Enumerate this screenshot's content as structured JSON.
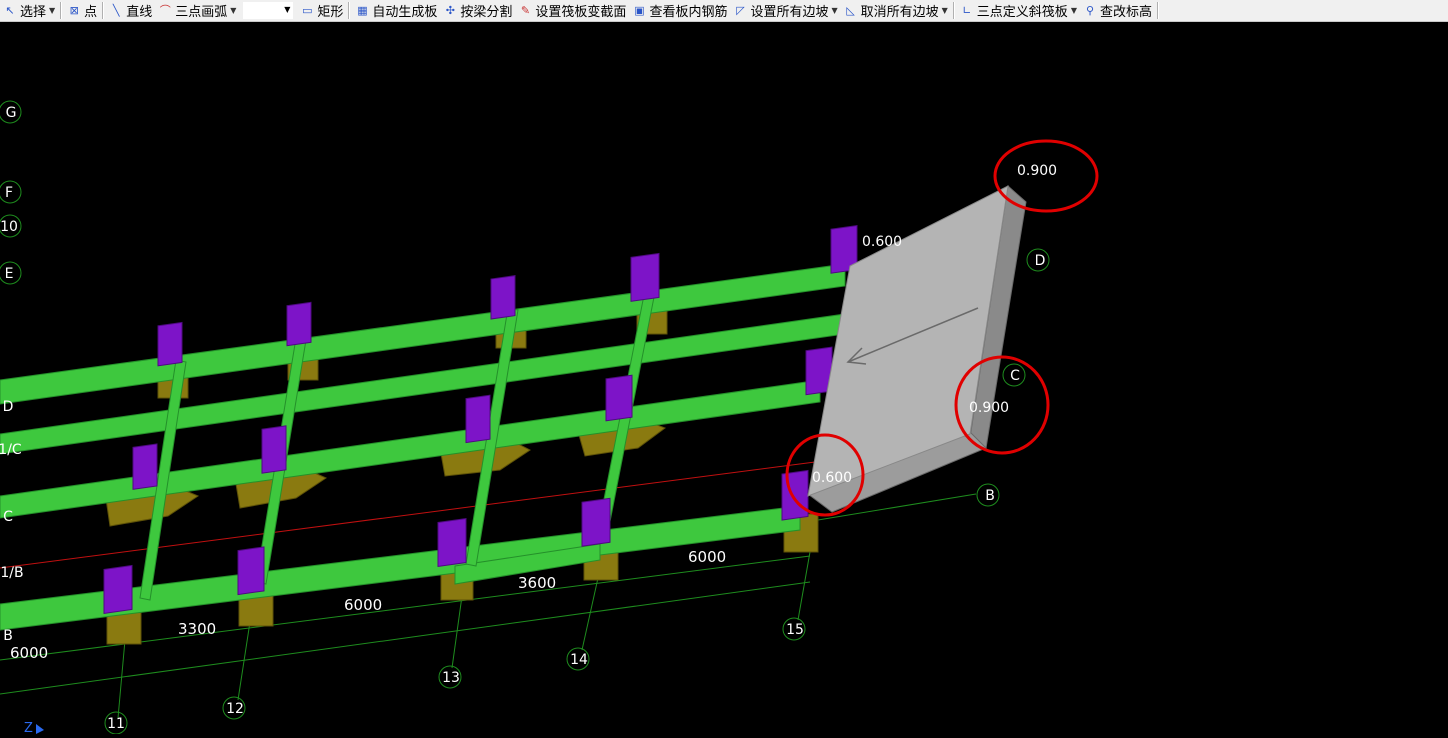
{
  "toolbar": {
    "items": [
      {
        "label": "选择",
        "icon": "cursor-arrow-icon",
        "dropdown": true
      },
      {
        "label": "点",
        "icon": "point-icon",
        "dropdown": false
      },
      {
        "label": "直线",
        "icon": "line-icon",
        "dropdown": false
      },
      {
        "label": "三点画弧",
        "icon": "arc-icon",
        "dropdown": true
      },
      {
        "label": "矩形",
        "icon": "rectangle-icon",
        "dropdown": false
      },
      {
        "label": "自动生成板",
        "icon": "grid-auto-icon",
        "dropdown": false
      },
      {
        "label": "按梁分割",
        "icon": "split-by-beam-icon",
        "dropdown": false
      },
      {
        "label": "设置筏板变截面",
        "icon": "variable-section-icon",
        "dropdown": false
      },
      {
        "label": "查看板内钢筋",
        "icon": "view-rebar-icon",
        "dropdown": false
      },
      {
        "label": "设置所有边坡",
        "icon": "set-slope-icon",
        "dropdown": true
      },
      {
        "label": "取消所有边坡",
        "icon": "cancel-slope-icon",
        "dropdown": true
      },
      {
        "label": "三点定义斜筏板",
        "icon": "three-point-slope-icon",
        "dropdown": true
      },
      {
        "label": "查改标高",
        "icon": "edit-elevation-icon",
        "dropdown": false
      }
    ],
    "select_value": ""
  },
  "viewport": {
    "axis_labels_left": [
      "G",
      "F",
      "10",
      "E",
      "D",
      "1/C",
      "C",
      "1/B",
      "B"
    ],
    "axis_labels_right": [
      "D",
      "C",
      "B"
    ],
    "axis_labels_bottom": [
      "11",
      "12",
      "13",
      "14",
      "15"
    ],
    "dimensions": [
      "6000",
      "3300",
      "6000",
      "3600",
      "6000"
    ],
    "elevations": {
      "top_corner": "0.900",
      "right_edge": "0.900",
      "top_left": "0.600",
      "bottom_left": "0.600"
    },
    "axis_indicator": "Z",
    "colors": {
      "background": "#000000",
      "beam": "#3ec83e",
      "column": "#7d14c8",
      "footing": "#8a7a10",
      "slab": "#b4b4b4",
      "grid_line": "#1e8c1e",
      "highlight_circle": "#e00000",
      "red_line": "#c01010"
    }
  }
}
